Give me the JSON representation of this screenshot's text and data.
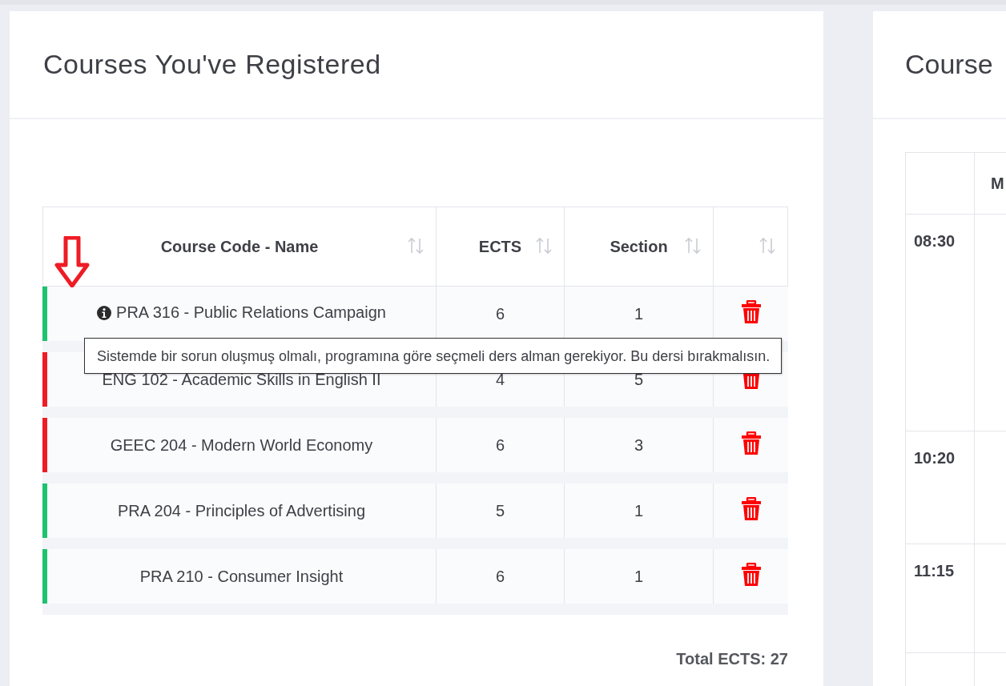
{
  "registered": {
    "title": "Courses You've Registered",
    "columns": [
      {
        "label": "Course Code - Name"
      },
      {
        "label": "ECTS"
      },
      {
        "label": "Section"
      },
      {}
    ],
    "rows": [
      {
        "course": "PRA 316 - Public Relations Campaign",
        "ects": "6",
        "section": "1",
        "color": "#1ec26f",
        "has_info": true
      },
      {
        "course": "ENG 102 - Academic Skills in English II",
        "ects": "4",
        "section": "5",
        "color": "#ee1c25",
        "has_info": false
      },
      {
        "course": "GEEC 204 - Modern World Economy",
        "ects": "6",
        "section": "3",
        "color": "#ee1c25",
        "has_info": false
      },
      {
        "course": "PRA 204 - Principles of Advertising",
        "ects": "5",
        "section": "1",
        "color": "#1ec26f",
        "has_info": false
      },
      {
        "course": "PRA 210 - Consumer Insight",
        "ects": "6",
        "section": "1",
        "color": "#1ec26f",
        "has_info": false
      }
    ],
    "total": "Total ECTS: 27",
    "tooltip": "Sistemde bir sorun oluşmuş olmalı, programına göre seçmeli ders alman gerekiyor. Bu dersi bırakmalısın."
  },
  "schedule": {
    "title": "Course",
    "day_header": "M",
    "times": [
      "08:30",
      "10:20",
      "11:15"
    ]
  }
}
